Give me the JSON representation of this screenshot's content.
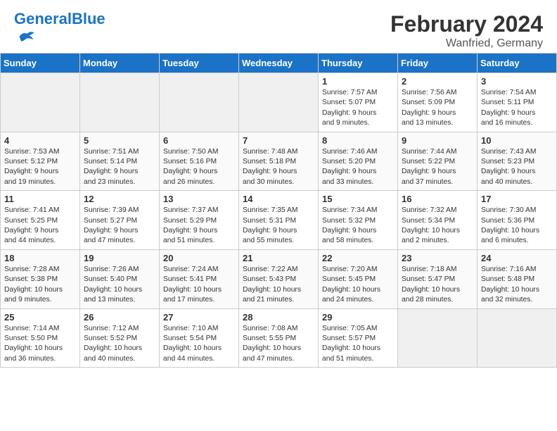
{
  "header": {
    "logo_general": "General",
    "logo_blue": "Blue",
    "month_year": "February 2024",
    "location": "Wanfried, Germany"
  },
  "days_of_week": [
    "Sunday",
    "Monday",
    "Tuesday",
    "Wednesday",
    "Thursday",
    "Friday",
    "Saturday"
  ],
  "weeks": [
    [
      {
        "day": "",
        "info": ""
      },
      {
        "day": "",
        "info": ""
      },
      {
        "day": "",
        "info": ""
      },
      {
        "day": "",
        "info": ""
      },
      {
        "day": "1",
        "info": "Sunrise: 7:57 AM\nSunset: 5:07 PM\nDaylight: 9 hours\nand 9 minutes."
      },
      {
        "day": "2",
        "info": "Sunrise: 7:56 AM\nSunset: 5:09 PM\nDaylight: 9 hours\nand 13 minutes."
      },
      {
        "day": "3",
        "info": "Sunrise: 7:54 AM\nSunset: 5:11 PM\nDaylight: 9 hours\nand 16 minutes."
      }
    ],
    [
      {
        "day": "4",
        "info": "Sunrise: 7:53 AM\nSunset: 5:12 PM\nDaylight: 9 hours\nand 19 minutes."
      },
      {
        "day": "5",
        "info": "Sunrise: 7:51 AM\nSunset: 5:14 PM\nDaylight: 9 hours\nand 23 minutes."
      },
      {
        "day": "6",
        "info": "Sunrise: 7:50 AM\nSunset: 5:16 PM\nDaylight: 9 hours\nand 26 minutes."
      },
      {
        "day": "7",
        "info": "Sunrise: 7:48 AM\nSunset: 5:18 PM\nDaylight: 9 hours\nand 30 minutes."
      },
      {
        "day": "8",
        "info": "Sunrise: 7:46 AM\nSunset: 5:20 PM\nDaylight: 9 hours\nand 33 minutes."
      },
      {
        "day": "9",
        "info": "Sunrise: 7:44 AM\nSunset: 5:22 PM\nDaylight: 9 hours\nand 37 minutes."
      },
      {
        "day": "10",
        "info": "Sunrise: 7:43 AM\nSunset: 5:23 PM\nDaylight: 9 hours\nand 40 minutes."
      }
    ],
    [
      {
        "day": "11",
        "info": "Sunrise: 7:41 AM\nSunset: 5:25 PM\nDaylight: 9 hours\nand 44 minutes."
      },
      {
        "day": "12",
        "info": "Sunrise: 7:39 AM\nSunset: 5:27 PM\nDaylight: 9 hours\nand 47 minutes."
      },
      {
        "day": "13",
        "info": "Sunrise: 7:37 AM\nSunset: 5:29 PM\nDaylight: 9 hours\nand 51 minutes."
      },
      {
        "day": "14",
        "info": "Sunrise: 7:35 AM\nSunset: 5:31 PM\nDaylight: 9 hours\nand 55 minutes."
      },
      {
        "day": "15",
        "info": "Sunrise: 7:34 AM\nSunset: 5:32 PM\nDaylight: 9 hours\nand 58 minutes."
      },
      {
        "day": "16",
        "info": "Sunrise: 7:32 AM\nSunset: 5:34 PM\nDaylight: 10 hours\nand 2 minutes."
      },
      {
        "day": "17",
        "info": "Sunrise: 7:30 AM\nSunset: 5:36 PM\nDaylight: 10 hours\nand 6 minutes."
      }
    ],
    [
      {
        "day": "18",
        "info": "Sunrise: 7:28 AM\nSunset: 5:38 PM\nDaylight: 10 hours\nand 9 minutes."
      },
      {
        "day": "19",
        "info": "Sunrise: 7:26 AM\nSunset: 5:40 PM\nDaylight: 10 hours\nand 13 minutes."
      },
      {
        "day": "20",
        "info": "Sunrise: 7:24 AM\nSunset: 5:41 PM\nDaylight: 10 hours\nand 17 minutes."
      },
      {
        "day": "21",
        "info": "Sunrise: 7:22 AM\nSunset: 5:43 PM\nDaylight: 10 hours\nand 21 minutes."
      },
      {
        "day": "22",
        "info": "Sunrise: 7:20 AM\nSunset: 5:45 PM\nDaylight: 10 hours\nand 24 minutes."
      },
      {
        "day": "23",
        "info": "Sunrise: 7:18 AM\nSunset: 5:47 PM\nDaylight: 10 hours\nand 28 minutes."
      },
      {
        "day": "24",
        "info": "Sunrise: 7:16 AM\nSunset: 5:48 PM\nDaylight: 10 hours\nand 32 minutes."
      }
    ],
    [
      {
        "day": "25",
        "info": "Sunrise: 7:14 AM\nSunset: 5:50 PM\nDaylight: 10 hours\nand 36 minutes."
      },
      {
        "day": "26",
        "info": "Sunrise: 7:12 AM\nSunset: 5:52 PM\nDaylight: 10 hours\nand 40 minutes."
      },
      {
        "day": "27",
        "info": "Sunrise: 7:10 AM\nSunset: 5:54 PM\nDaylight: 10 hours\nand 44 minutes."
      },
      {
        "day": "28",
        "info": "Sunrise: 7:08 AM\nSunset: 5:55 PM\nDaylight: 10 hours\nand 47 minutes."
      },
      {
        "day": "29",
        "info": "Sunrise: 7:05 AM\nSunset: 5:57 PM\nDaylight: 10 hours\nand 51 minutes."
      },
      {
        "day": "",
        "info": ""
      },
      {
        "day": "",
        "info": ""
      }
    ]
  ]
}
